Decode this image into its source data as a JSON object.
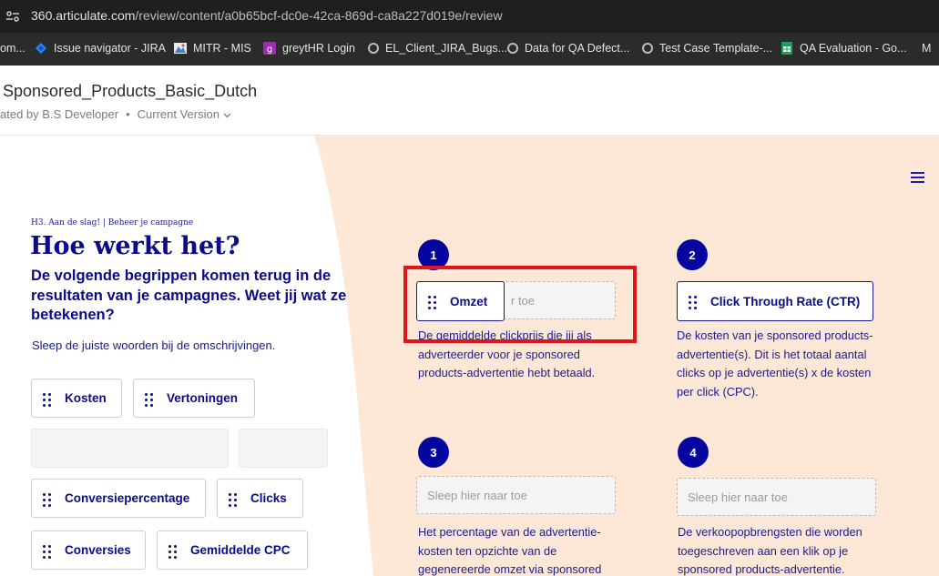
{
  "browser": {
    "url_main": "360.articulate.com",
    "url_path": "/review/content/a0b65bcf-dc0e-42ca-869d-ca8a227d019e/review",
    "bookmarks": [
      {
        "label": "om...",
        "icon": "none"
      },
      {
        "label": "Issue navigator - JIRA",
        "icon": "jira-icon"
      },
      {
        "label": "MITR - MIS",
        "icon": "mitr-icon"
      },
      {
        "label": "greytHR Login",
        "icon": "greythr-icon"
      },
      {
        "label": "EL_Client_JIRA_Bugs...",
        "icon": "globe-icon"
      },
      {
        "label": "Data for QA Defect...",
        "icon": "globe-icon"
      },
      {
        "label": "Test Case Template-...",
        "icon": "globe-icon"
      },
      {
        "label": "QA Evaluation - Go...",
        "icon": "sheets-icon"
      },
      {
        "label": "M",
        "icon": "none"
      }
    ]
  },
  "header": {
    "title": "Sponsored_Products_Basic_Dutch",
    "created_by": "ated by B.S Developer",
    "version": "Current Version"
  },
  "slide": {
    "breadcrumb": "H3. Aan de slag! | Beheer je campagne",
    "heading": "Hoe werkt het?",
    "subheading": "De volgende begrippen komen terug in de resultaten van je campagnes. Weet jij wat ze betekenen?",
    "instruction": "Sleep de juiste woorden bij de omschrijvingen.",
    "chips": {
      "kosten": "Kosten",
      "vertoningen": "Vertoningen",
      "conversiepercentage": "Conversiepercentage",
      "clicks": "Clicks",
      "conversies": "Conversies",
      "gemiddelde_cpc": "Gemiddelde CPC"
    },
    "items": [
      {
        "number": "1",
        "placed": "Omzet",
        "drop_text": "r toe",
        "description": "De gemiddelde clickprijs die jij als adverteerder voor je sponsored products-advertentie hebt betaald."
      },
      {
        "number": "2",
        "placed": "Click Through Rate (CTR)",
        "description": "De kosten van je sponsored products-advertentie(s). Dit is het totaal aantal clicks op je advertentie(s) x de kosten per click (CPC)."
      },
      {
        "number": "3",
        "drop_text": "Sleep hier naar toe",
        "description": "Het percentage van de advertentie-kosten ten opzichte van de gegenereerde omzet via sponsored products"
      },
      {
        "number": "4",
        "drop_text": "Sleep hier naar toe",
        "description": "De verkoopopbrengsten die worden toegeschreven aan een klik op je sponsored products-advertentie."
      }
    ]
  },
  "colors": {
    "accent": "#0505a0",
    "peach": "#fde8d7",
    "highlight": "#e0141b"
  }
}
